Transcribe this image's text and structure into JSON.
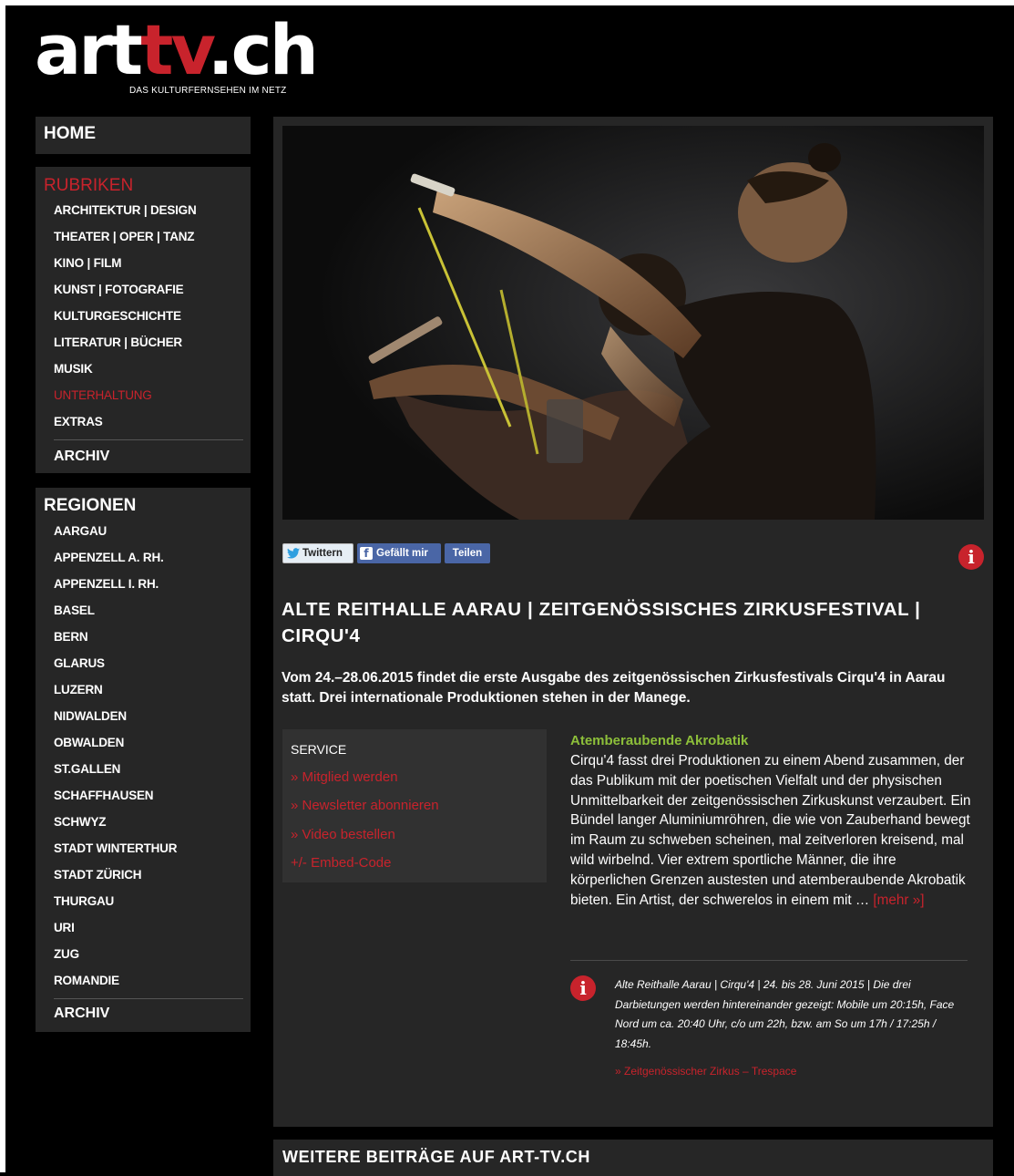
{
  "logo": {
    "art": "art",
    "tv": "tv",
    "ch": ".ch",
    "tagline": "DAS KULTURFERNSEHEN IM NETZ"
  },
  "sidebar": {
    "home": "HOME",
    "rubriken": {
      "title": "RUBRIKEN",
      "items": [
        "ARCHITEKTUR | DESIGN",
        "THEATER | OPER | TANZ",
        "KINO | FILM",
        "KUNST | FOTOGRAFIE",
        "KULTURGESCHICHTE",
        "LITERATUR | BÜCHER",
        "MUSIK",
        "UNTERHALTUNG",
        "EXTRAS"
      ],
      "archiv": "ARCHIV"
    },
    "regionen": {
      "title": "REGIONEN",
      "items": [
        "AARGAU",
        "APPENZELL A. RH.",
        "APPENZELL I. RH.",
        "BASEL",
        "BERN",
        "GLARUS",
        "LUZERN",
        "NIDWALDEN",
        "OBWALDEN",
        "ST.GALLEN",
        "SCHAFFHAUSEN",
        "SCHWYZ",
        "STADT WINTERTHUR",
        "STADT ZÜRICH",
        "THURGAU",
        "URI",
        "ZUG",
        "ROMANDIE"
      ],
      "archiv": "ARCHIV"
    }
  },
  "share": {
    "twitter": "Twittern",
    "facebook": "Gefällt mir",
    "teilen": "Teilen"
  },
  "info_icon_glyph": "i",
  "article": {
    "title": "ALTE REITHALLE AARAU | ZEITGENÖSSISCHES ZIRKUSFESTIVAL | CIRQU'4",
    "lead": "Vom 24.–28.06.2015 findet die erste Ausgabe des zeitgenössischen Zirkusfestivals Cirqu'4 in Aarau statt. Drei internationale Produktionen stehen in der Manege.",
    "subheading": "Atemberaubende Akrobatik",
    "body": "Cirqu'4 fasst drei Produktionen zu einem Abend zusammen, der das Publikum mit der poetischen Vielfalt und der physischen Unmittelbarkeit der zeitgenössischen Zirkuskunst verzaubert. Ein Bündel langer Aluminiumröhren, die wie von Zauberhand bewegt im Raum zu schweben scheinen, mal zeitverloren kreisend, mal wild wirbelnd. Vier extrem sportliche Männer, die ihre körperlichen Grenzen austesten und atemberaubende Akrobatik bieten. Ein Artist, der schwerelos in einem mit … ",
    "more": "[mehr »]",
    "info": "Alte Reithalle Aarau | Cirqu'4 | 24. bis 28. Juni 2015 | Die drei Darbietungen werden hintereinander gezeigt: Mobile um 20:15h, Face Nord um ca. 20:40 Uhr, c/o um 22h, bzw. am So um 17h / 17:25h / 18:45h.",
    "info_link": "» Zeitgenössischer Zirkus – Trespace"
  },
  "service": {
    "title": "SERVICE",
    "links": [
      "» Mitglied werden",
      "» Newsletter abonnieren",
      "» Video bestellen",
      "+/- Embed-Code"
    ]
  },
  "weitere": {
    "title": "WEITERE BEITRÄGE AUF ART-TV.CH"
  },
  "colors": {
    "accent": "#c8232c",
    "subheading": "#8dbf3a",
    "panel": "#262626",
    "background": "#000000"
  }
}
